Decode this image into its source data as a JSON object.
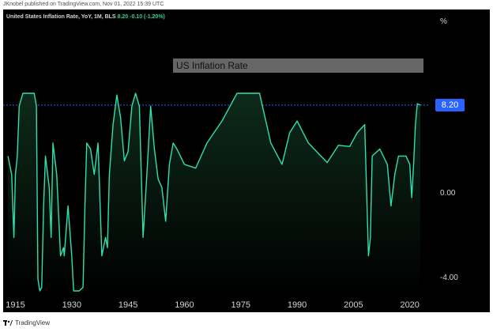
{
  "caption": "JKnobel published on TradingView.com, Nov 01, 2022 15:39 UTC",
  "symbol_line": {
    "name": "United States Inflation Rate, YoY, 1M, BLS",
    "value": "8.20",
    "change": "-0.10 (-1.20%)"
  },
  "unit": "%",
  "title_box": "US Inflation Rate",
  "last_value_badge": "8.20",
  "footer": {
    "brand": "TradingView"
  },
  "colors": {
    "line": "#2fe0b0",
    "background": "#000000",
    "area_top": "#0d2a1a",
    "badge": "#2962ff",
    "text": "#d1d4dc"
  },
  "chart_data": {
    "type": "area",
    "title": "US Inflation Rate",
    "xlabel": "",
    "ylabel": "%",
    "x_ticks": [
      "1915",
      "1930",
      "1945",
      "1960",
      "1975",
      "1990",
      "2005",
      "2020"
    ],
    "y_ticks": [
      "8.20",
      "0.00",
      "-4.00"
    ],
    "axis_scale": "log",
    "xlim": [
      1913,
      2022.8
    ],
    "series": [
      {
        "name": "United States Inflation Rate, YoY, 1M, BLS",
        "x": [
          1913,
          1914,
          1914.6,
          1915,
          1915.5,
          1916,
          1917,
          1918,
          1919,
          1920,
          1920.6,
          1921,
          1921.5,
          1922,
          1922.5,
          1923,
          1924,
          1924.5,
          1925,
          1926,
          1927,
          1927.8,
          1928,
          1929,
          1930,
          1930.5,
          1931,
          1932,
          1933,
          1933.5,
          1934,
          1935,
          1936,
          1937,
          1938,
          1939,
          1939.5,
          1940,
          1941,
          1942,
          1943,
          1944,
          1945,
          1946,
          1947,
          1948,
          1949,
          1950,
          1951,
          1952,
          1953,
          1954,
          1955,
          1956,
          1957,
          1958,
          1960,
          1963,
          1966,
          1970,
          1974,
          1979,
          1980,
          1983,
          1986,
          1988,
          1990,
          1993,
          1998,
          2001,
          2004,
          2006,
          2008,
          2009,
          2009.5,
          2010,
          2012,
          2014,
          2015,
          2016,
          2017,
          2019,
          2020,
          2020.5,
          2021,
          2021.5,
          2022,
          2022.8
        ],
        "y": [
          2.0,
          1.0,
          -1.0,
          1.0,
          2.0,
          8.0,
          17.0,
          18.0,
          15.0,
          16.0,
          8.0,
          -4.0,
          -10.0,
          -5.0,
          0.0,
          2.0,
          0.5,
          -1.0,
          3.0,
          1.0,
          -2.0,
          -1.5,
          -2.0,
          0.0,
          -2.0,
          -6.0,
          -9.0,
          -10.0,
          -5.0,
          0.0,
          3.0,
          2.5,
          1.0,
          3.0,
          -2.0,
          -1.0,
          -1.5,
          1.0,
          5.0,
          10.5,
          6.0,
          1.7,
          2.3,
          8.0,
          14.0,
          8.0,
          -1.0,
          1.0,
          8.0,
          2.5,
          0.8,
          0.5,
          -0.4,
          1.5,
          3.0,
          2.5,
          1.5,
          1.3,
          3.0,
          5.5,
          11.0,
          12.0,
          14.0,
          3.0,
          1.5,
          4.0,
          5.5,
          3.0,
          1.6,
          2.8,
          2.7,
          4.0,
          5.0,
          -2.0,
          -1.0,
          2.0,
          2.5,
          1.5,
          0.0,
          1.0,
          2.0,
          2.0,
          1.5,
          0.2,
          1.4,
          5.0,
          8.5,
          8.2
        ]
      }
    ]
  }
}
